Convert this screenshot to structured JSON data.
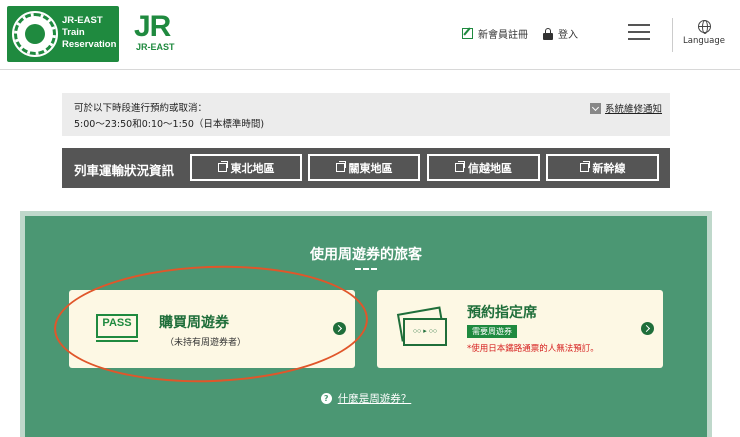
{
  "header": {
    "logo_text": [
      "JR-EAST",
      "Train",
      "Reservation"
    ],
    "jr_mark": "JR",
    "jr_sub": "JR-EAST",
    "register_label": "新會員註冊",
    "login_label": "登入",
    "language_label": "Language"
  },
  "notice": {
    "line1": "可於以下時段進行預約或取消：",
    "line2": "5:00～23:50和0:10～1:50（日本標準時間)",
    "maintenance_label": "系統維修通知"
  },
  "train_status": {
    "title": "列車運輸狀況資訊",
    "regions": [
      "東北地區",
      "關東地區",
      "信越地區",
      "新幹線"
    ]
  },
  "pass_section": {
    "title": "使用周遊券的旅客",
    "buy_card": {
      "badge": "PASS",
      "title": "購買周遊券",
      "subtitle": "（未持有周遊券者）"
    },
    "reserve_card": {
      "ticket_text": "○○ ▸ ○○",
      "title": "預約指定席",
      "badge": "需要周遊券",
      "note": "*使用日本鐵路通票的人無法預訂。"
    },
    "faq_label": "什麼是周遊券？"
  },
  "colors": {
    "brand_green": "#1f8a3f",
    "section_green": "#4b9773",
    "annotation_red": "#e0562a"
  }
}
